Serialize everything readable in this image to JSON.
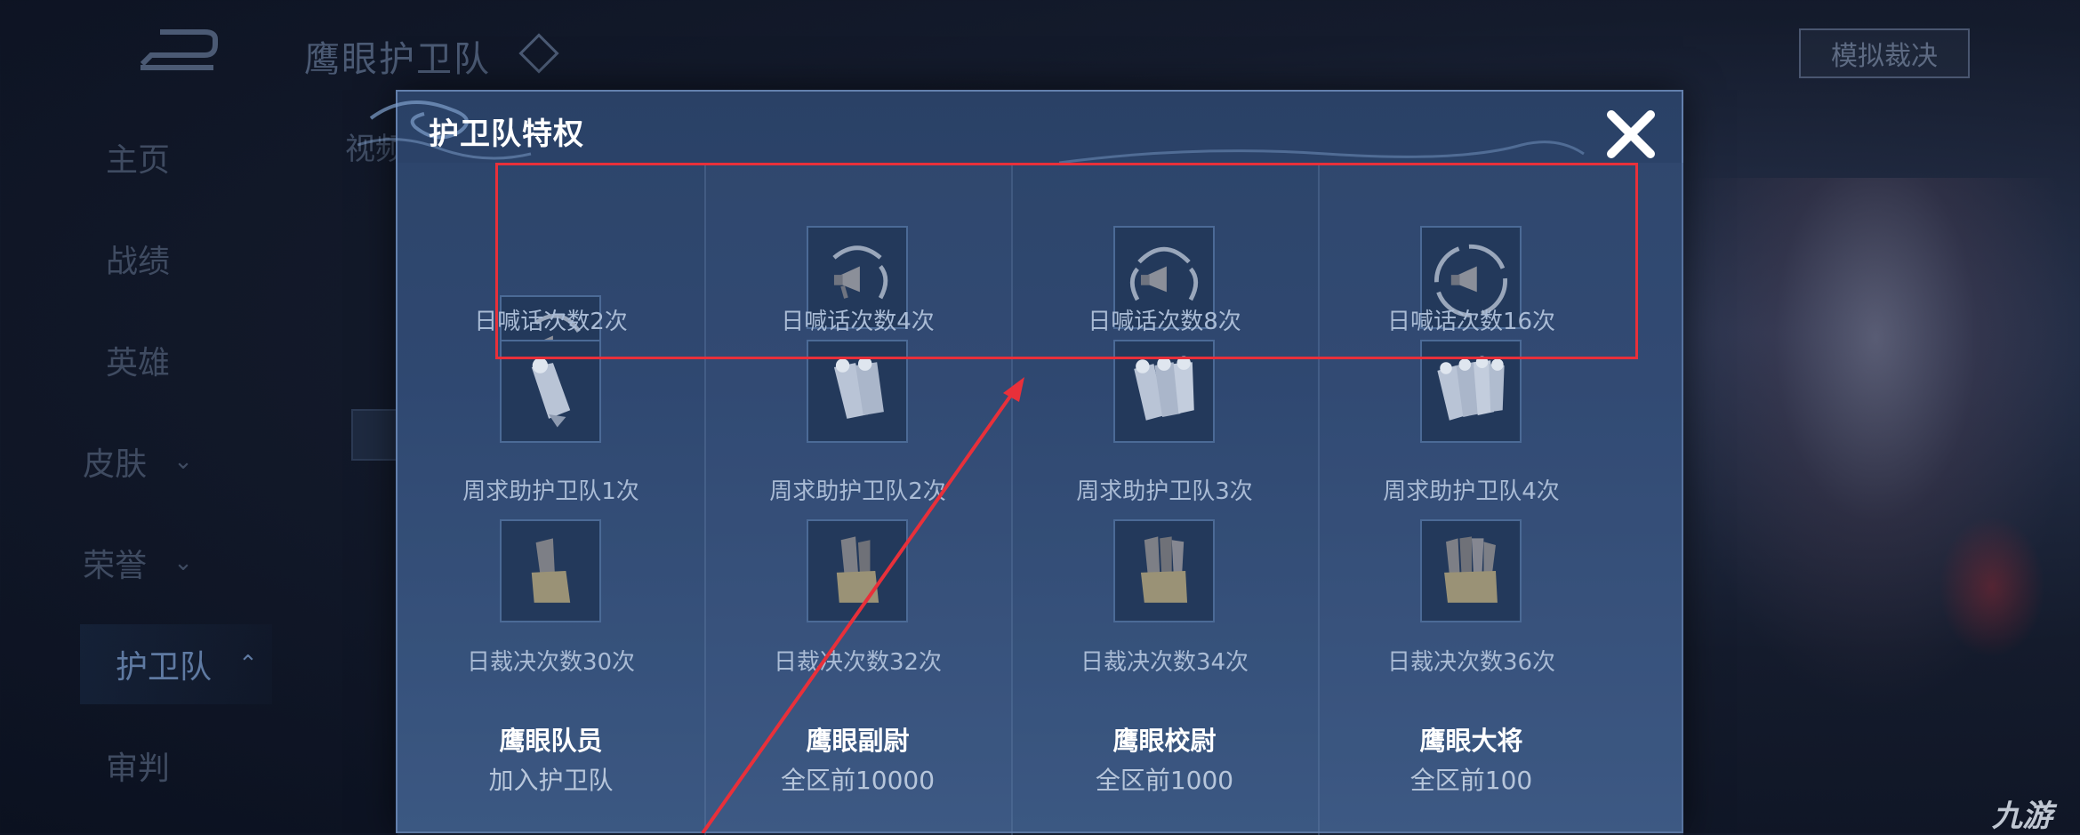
{
  "app": {
    "page_title": "鹰眼护卫队",
    "sub_tab_partial": "视频",
    "simulate_button": "模拟裁决"
  },
  "sidebar": {
    "items": [
      {
        "label": "主页"
      },
      {
        "label": "战绩"
      },
      {
        "label": "英雄"
      },
      {
        "label": "皮肤",
        "chevron": "⌄"
      },
      {
        "label": "荣誉",
        "chevron": "⌄"
      },
      {
        "label": "护卫队",
        "chevron": "⌃"
      },
      {
        "label": "审判"
      }
    ]
  },
  "modal": {
    "title": "护卫队特权",
    "close_icon": "close-x-icon",
    "columns": [
      {
        "shout": "日喊话次数2次",
        "help": "周求助护卫队1次",
        "verdict": "日裁决次数30次",
        "rank": "鹰眼队员",
        "requirement": "加入护卫队"
      },
      {
        "shout": "日喊话次数4次",
        "help": "周求助护卫队2次",
        "verdict": "日裁决次数32次",
        "rank": "鹰眼副尉",
        "requirement": "全区前10000"
      },
      {
        "shout": "日喊话次数8次",
        "help": "周求助护卫队3次",
        "verdict": "日裁决次数34次",
        "rank": "鹰眼校尉",
        "requirement": "全区前1000"
      },
      {
        "shout": "日喊话次数16次",
        "help": "周求助护卫队4次",
        "verdict": "日裁决次数36次",
        "rank": "鹰眼大将",
        "requirement": "全区前100"
      }
    ]
  },
  "watermark": "九游",
  "colors": {
    "highlight": "#e8303a",
    "modal_bg": "#2e4670",
    "accent_border": "#6380ad"
  }
}
